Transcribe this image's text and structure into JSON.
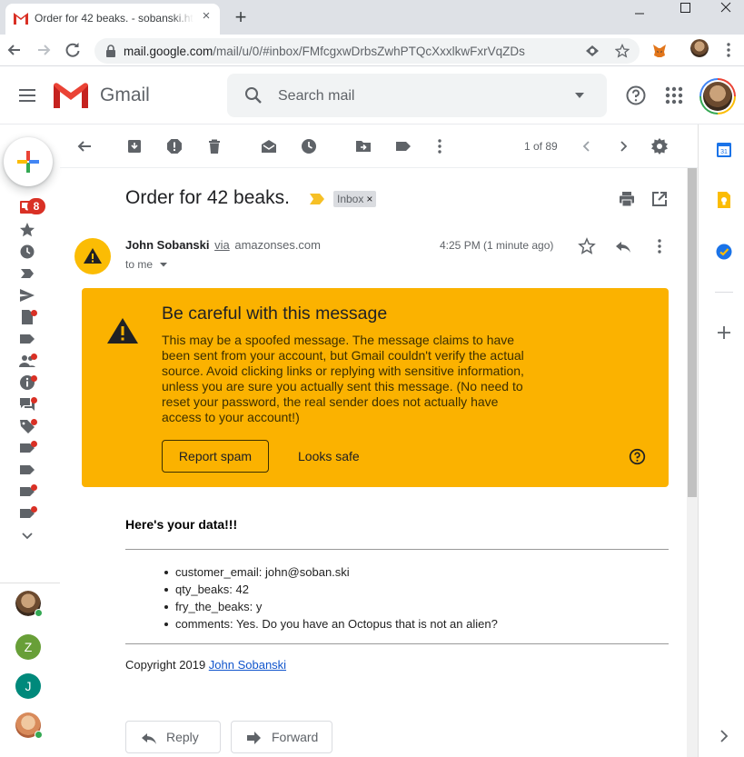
{
  "browser": {
    "tab_title": "Order for 42 beaks. - sobanski.ht",
    "tab_close": "×",
    "new_tab": "+",
    "url_host": "mail.google.com",
    "url_path": "/mail/u/0/#inbox/FMfcgxwDrbsZwhPTQcXxxlkwFxrVqZDs"
  },
  "gmail": {
    "wordmark": "Gmail",
    "search_placeholder": "Search mail",
    "unread_badge": "8"
  },
  "toolbar": {
    "pager": "1 of 89"
  },
  "message": {
    "subject": "Order for 42 beaks.",
    "label": "Inbox",
    "label_remove": "×",
    "sender_name": "John Sobanski",
    "via": "via",
    "via_domain": "amazonses.com",
    "to": "to me",
    "time": "4:25 PM (1 minute ago)"
  },
  "warning": {
    "title": "Be careful with this message",
    "body": "This may be a spoofed message. The message claims to have been sent from your account, but Gmail couldn't verify the actual source. Avoid clicking links or replying with sensitive information, unless you are sure you actually sent this message. (No need to reset your password, the real sender does not actually have access to your account!)",
    "report_label": "Report spam",
    "safe_label": "Looks safe"
  },
  "body": {
    "heading": "Here's your data!!!",
    "items": [
      "customer_email: john@soban.ski",
      "qty_beaks: 42",
      "fry_the_beaks: y",
      "comments: Yes. Do you have an Octopus that is not an alien?"
    ],
    "copyright_prefix": "Copyright 2019 ",
    "copyright_link": "John Sobanski"
  },
  "actions": {
    "reply_label": "Reply",
    "forward_label": "Forward"
  },
  "hangouts": {
    "contact_z": "Z",
    "contact_j": "J"
  },
  "colors": {
    "warning_bg": "#fbb200",
    "badge_red": "#d93025",
    "link_blue": "#1155cc",
    "online_green": "#34a853"
  }
}
